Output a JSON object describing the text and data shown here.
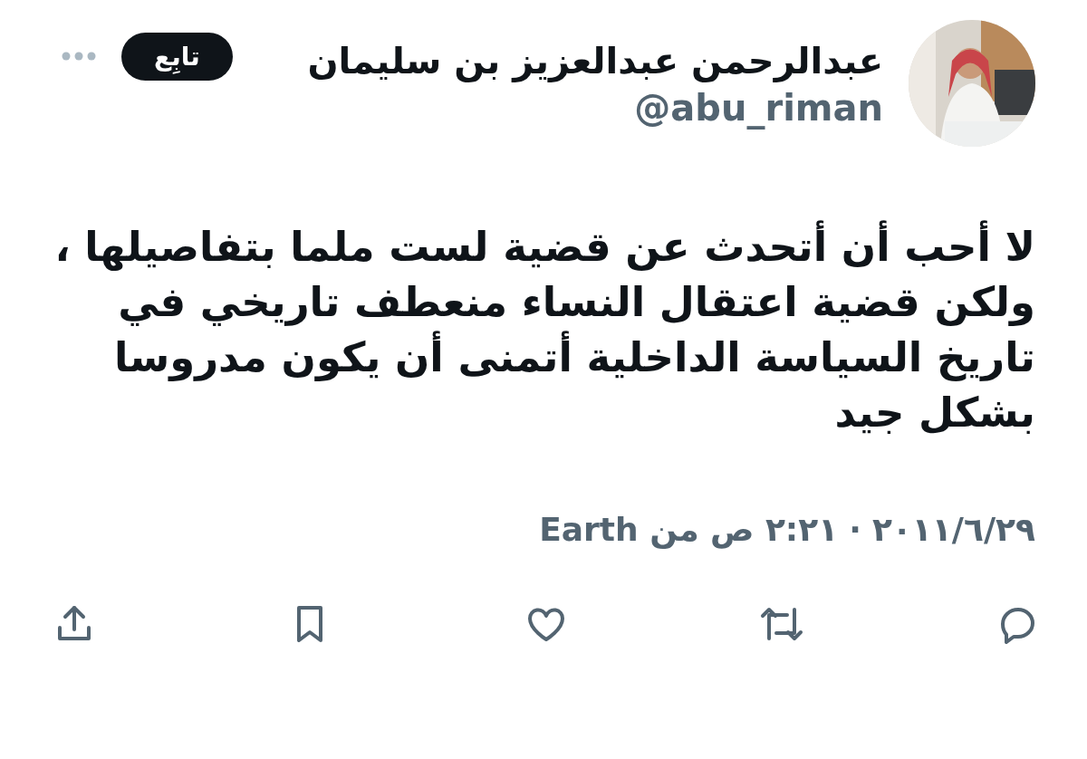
{
  "author": {
    "name": "عبدالرحمن عبدالعزيز بن سليمان",
    "handle": "@abu_riman"
  },
  "follow_button": {
    "label": "تابِع"
  },
  "tweet": {
    "text": "لا أحب أن أتحدث عن قضية لست ملما بتفاصيلها ، ولكن قضية اعتقال النساء منعطف تاريخي في تاريخ السياسة الداخلية أتمنى أن يكون مدروسا بشكل جيد"
  },
  "meta": {
    "date": "٢٠١١/٦/٢٩",
    "separator": "·",
    "time": "٢:٢١ ص",
    "source": "من Earth"
  },
  "actions": [
    {
      "kind": "reply"
    },
    {
      "kind": "retweet"
    },
    {
      "kind": "like"
    },
    {
      "kind": "bookmark"
    },
    {
      "kind": "share"
    }
  ]
}
